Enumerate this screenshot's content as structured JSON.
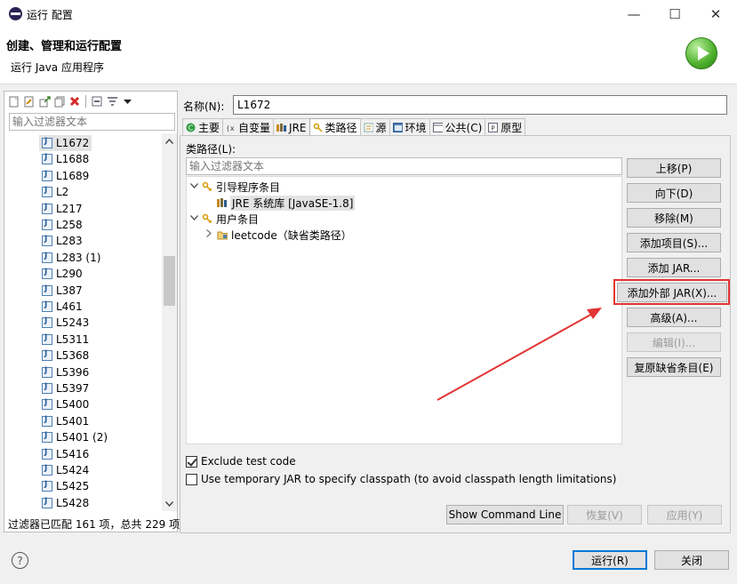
{
  "window": {
    "title": "运行 配置",
    "minimize_glyph": "—",
    "maximize_glyph": "☐",
    "close_glyph": "✕"
  },
  "header": {
    "title": "创建、管理和运行配置",
    "subtitle": "运行 Java 应用程序",
    "icon": "run-icon"
  },
  "sidebar": {
    "filter_placeholder": "输入过滤器文本",
    "items": [
      "L1672",
      "L1688",
      "L1689",
      "L2",
      "L217",
      "L258",
      "L283",
      "L283 (1)",
      "L290",
      "L387",
      "L461",
      "L5243",
      "L5311",
      "L5368",
      "L5396",
      "L5397",
      "L5400",
      "L5401",
      "L5401 (2)",
      "L5416",
      "L5424",
      "L5425",
      "L5428"
    ],
    "selected": "L1672",
    "status": "过滤器已匹配 161 项，总共 229 项",
    "scroll_position": 0.36
  },
  "config": {
    "name_label": "名称(N):",
    "name_value": "L1672"
  },
  "tabs": [
    {
      "label": "主要",
      "icon": "main-icon"
    },
    {
      "label": "自变量",
      "icon": "arguments-icon"
    },
    {
      "label": "JRE",
      "icon": "jre-icon"
    },
    {
      "label": "类路径",
      "icon": "classpath-icon",
      "active": true
    },
    {
      "label": "源",
      "icon": "source-icon"
    },
    {
      "label": "环境",
      "icon": "environment-icon"
    },
    {
      "label": "公共(C)",
      "icon": "common-icon"
    },
    {
      "label": "原型",
      "icon": "prototype-icon"
    }
  ],
  "classpath": {
    "label": "类路径(L):",
    "filter_placeholder": "输入过滤器文本",
    "tree": {
      "bootstrap_label": "引导程序条目",
      "jre_entry": "JRE 系统库 [JavaSE-1.8]",
      "user_label": "用户条目",
      "project_entry": "leetcode（缺省类路径）"
    },
    "buttons": {
      "up": "上移(P)",
      "down": "向下(D)",
      "remove": "移除(M)",
      "add_projects": "添加项目(S)...",
      "add_jars": "添加 JAR...",
      "add_external_jars": "添加外部 JAR(X)...",
      "advanced": "高级(A)...",
      "edit": "编辑(I)...",
      "restore_default": "复原缺省条目(E)"
    },
    "exclude_test_code": "Exclude test code",
    "use_temp_jar": "Use temporary JAR to specify classpath (to avoid classpath length limitations)"
  },
  "footer": {
    "show_command_line": "Show Command Line",
    "revert": "恢复(V)",
    "apply": "应用(Y)",
    "run": "运行(R)",
    "close": "关闭"
  },
  "colors": {
    "annotation_red": "#e23434",
    "run_green": "#4cae2a"
  }
}
